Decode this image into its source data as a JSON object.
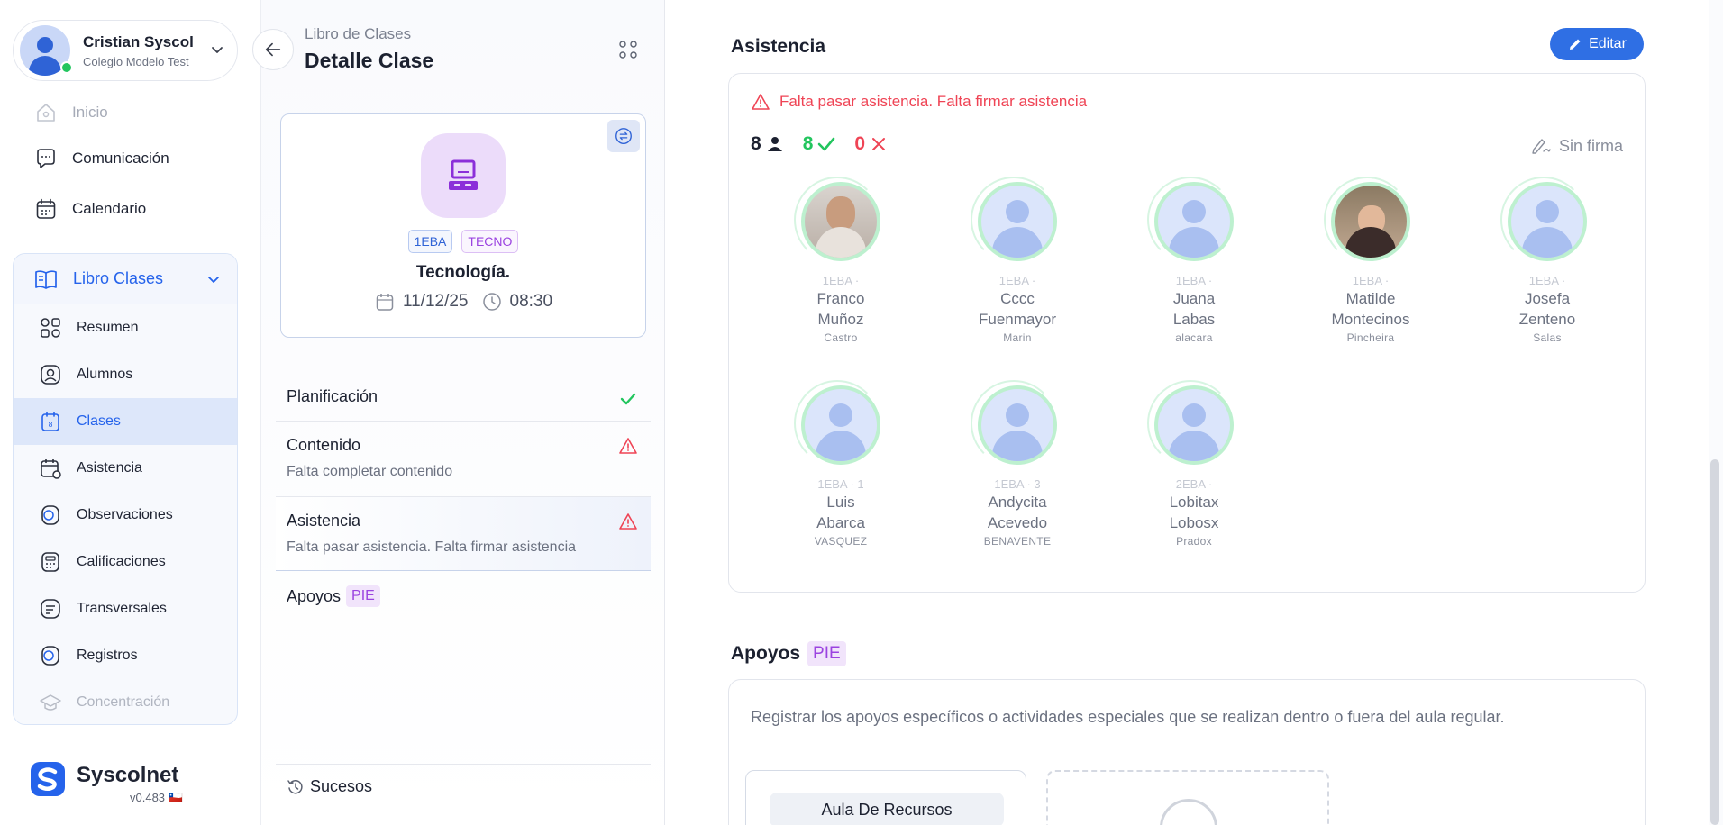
{
  "user": {
    "name": "Cristian Syscol",
    "school": "Colegio Modelo Test"
  },
  "nav": {
    "top": [
      {
        "label": "Inicio",
        "icon": "home-icon"
      },
      {
        "label": "Comunicación",
        "icon": "chat-icon"
      },
      {
        "label": "Calendario",
        "icon": "calendar-icon"
      }
    ],
    "libro_label": "Libro Clases",
    "libro_items": [
      {
        "label": "Resumen",
        "icon": "grid-icon"
      },
      {
        "label": "Alumnos",
        "icon": "student-icon"
      },
      {
        "label": "Clases",
        "icon": "class-calendar-icon"
      },
      {
        "label": "Asistencia",
        "icon": "attendance-icon"
      },
      {
        "label": "Observaciones",
        "icon": "observations-icon"
      },
      {
        "label": "Calificaciones",
        "icon": "grades-icon"
      },
      {
        "label": "Transversales",
        "icon": "transversal-icon"
      },
      {
        "label": "Registros",
        "icon": "records-icon"
      },
      {
        "label": "Concentración",
        "icon": "graduation-icon"
      }
    ]
  },
  "brand": {
    "name": "Syscolnet",
    "version": "v0.483 🇨🇱"
  },
  "header": {
    "breadcrumb": "Libro de Clases",
    "title": "Detalle Clase"
  },
  "class_card": {
    "badge_course": "1EBA",
    "badge_subject": "TECNO",
    "name": "Tecnología.",
    "date": "11/12/25",
    "time": "08:30"
  },
  "steps": {
    "planificacion": {
      "title": "Planificación",
      "status": "ok"
    },
    "contenido": {
      "title": "Contenido",
      "sub": "Falta completar contenido",
      "status": "warning"
    },
    "asistencia": {
      "title": "Asistencia",
      "sub": "Falta pasar asistencia. Falta firmar asistencia",
      "status": "warning"
    },
    "apoyos": {
      "title": "Apoyos",
      "chip": "PIE"
    }
  },
  "sucesos": "Sucesos",
  "attendance": {
    "title": "Asistencia",
    "edit_label": "Editar",
    "warning": "Falta pasar asistencia. Falta firmar asistencia",
    "total": "8",
    "present": "8",
    "absent": "0",
    "signature": "Sin firma",
    "students": [
      {
        "course": "1EBA ·",
        "first": "Franco",
        "second": "Muñoz",
        "last": "Castro",
        "photo": "male-photo"
      },
      {
        "course": "1EBA ·",
        "first": "Cccc",
        "second": "Fuenmayor",
        "last": "Marin",
        "photo": "placeholder"
      },
      {
        "course": "1EBA ·",
        "first": "Juana",
        "second": "Labas",
        "last": "alacara",
        "photo": "placeholder"
      },
      {
        "course": "1EBA ·",
        "first": "Matilde",
        "second": "Montecinos",
        "last": "Pincheira",
        "photo": "female-photo"
      },
      {
        "course": "1EBA ·",
        "first": "Josefa",
        "second": "Zenteno",
        "last": "Salas",
        "photo": "placeholder"
      },
      {
        "course": "1EBA · 1",
        "first": "Luis",
        "second": "Abarca",
        "last": "VASQUEZ",
        "photo": "placeholder"
      },
      {
        "course": "1EBA · 3",
        "first": "Andycita",
        "second": "Acevedo",
        "last": "BENAVENTE",
        "photo": "placeholder"
      },
      {
        "course": "2EBA ·",
        "first": "Lobitax",
        "second": "Lobosx",
        "last": "Pradox",
        "photo": "placeholder"
      }
    ]
  },
  "apoyos": {
    "title": "Apoyos",
    "chip": "PIE",
    "description": "Registrar los apoyos específicos o actividades especiales que se realizan dentro o fuera del aula regular.",
    "aula_label": "Aula De Recursos"
  },
  "colors": {
    "accent": "#2563eb",
    "success": "#22c55e",
    "danger": "#ef4455",
    "pie": "#9b43e0"
  }
}
